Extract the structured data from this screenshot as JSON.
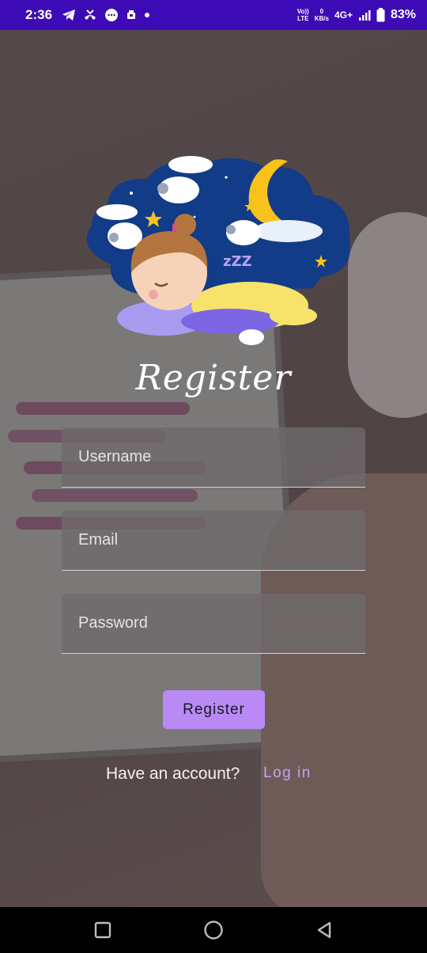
{
  "status_bar": {
    "time": "2:36",
    "volte_top": "Vo))",
    "volte_bottom": "LTE",
    "speed_value": "0",
    "speed_unit": "KB/s",
    "network": "4G+",
    "battery": "83%",
    "icons": [
      "telegram-icon",
      "missed-call-icon",
      "messages-icon",
      "app-notification-icon",
      "dot-icon",
      "signal-icon",
      "battery-icon"
    ]
  },
  "illustration": {
    "icon": "sleeping-child-illustration",
    "text": "zZZ"
  },
  "register_title": "Register",
  "form": {
    "username_placeholder": "Username",
    "email_placeholder": "Email",
    "password_placeholder": "Password",
    "submit_label": "Register"
  },
  "footer": {
    "have_account": "Have an account?",
    "login_label": "Log in"
  },
  "nav": {
    "icons": [
      "recents-square-icon",
      "home-circle-icon",
      "back-triangle-icon"
    ]
  },
  "colors": {
    "status_bar": "#3d0bb5",
    "accent": "#b98af5",
    "link": "#c4a3f5",
    "night_sky": "#123b88",
    "moon": "#f7c21c"
  }
}
